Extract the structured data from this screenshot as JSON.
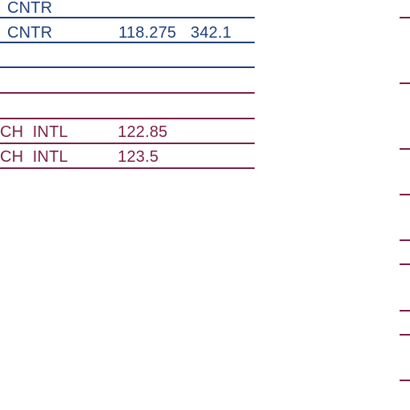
{
  "colors": {
    "navy": "#1f3f7a",
    "maroon": "#7a1f45"
  },
  "rows": [
    {
      "id": "r0",
      "name": "CNTR",
      "freq1": "",
      "freq2": ""
    },
    {
      "id": "r1",
      "name": "CNTR",
      "freq1": "118.275",
      "freq2": "342.1"
    },
    {
      "id": "r2",
      "name": "",
      "freq1": "",
      "freq2": ""
    },
    {
      "id": "r3",
      "name": "",
      "freq1": "",
      "freq2": ""
    },
    {
      "id": "r4",
      "name": "CH  INTL",
      "freq1": "122.85",
      "freq2": ""
    },
    {
      "id": "r5",
      "name": "CH  INTL",
      "freq1": "123.5",
      "freq2": ""
    }
  ]
}
